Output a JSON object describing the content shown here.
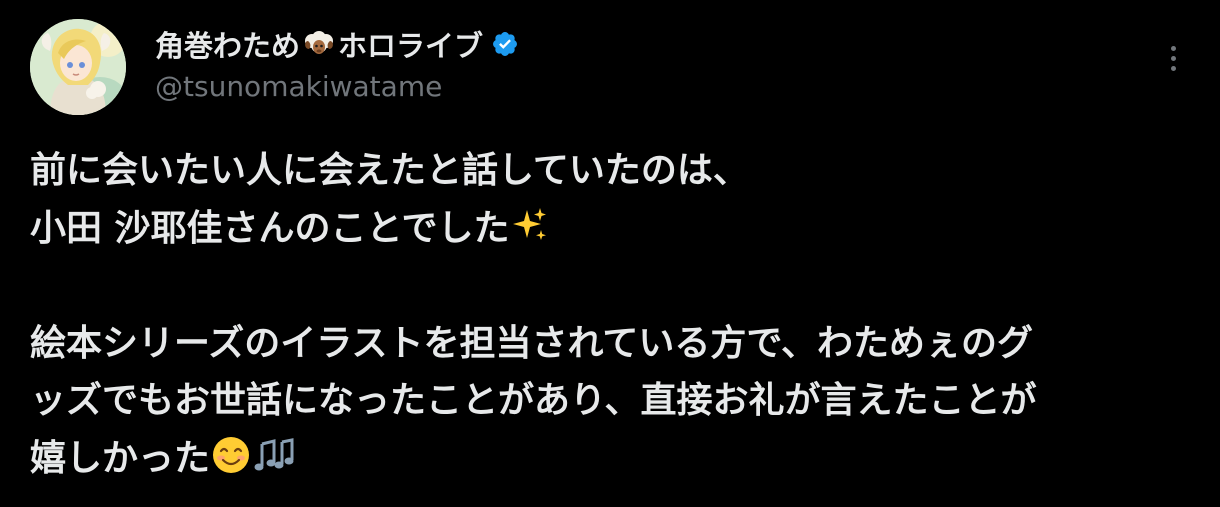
{
  "author": {
    "display_name": "角巻わため",
    "display_name_suffix": "ホロライブ",
    "name_emoji": "sheep-icon",
    "verified_icon": "verified-badge-icon",
    "handle": "@tsunomakiwatame"
  },
  "menu": {
    "more_icon": "more-options-icon"
  },
  "post": {
    "lines": [
      "前に会いたい人に会えたと話していたのは、",
      "小田 沙耶佳さんのことでした",
      "",
      "絵本シリーズのイラストを担当されている方で、わためぇのグ",
      "ッズでもお世話になったことがあり、直接お礼が言えたことが",
      "嬉しかった"
    ],
    "line2_emoji": "sparkles-icon",
    "line6_emojis": [
      "smiling-face-icon",
      "musical-notes-icon"
    ]
  },
  "colors": {
    "background": "#000000",
    "text": "#e7e9ea",
    "secondary_text": "#71767b",
    "verified": "#1d9bf0"
  }
}
